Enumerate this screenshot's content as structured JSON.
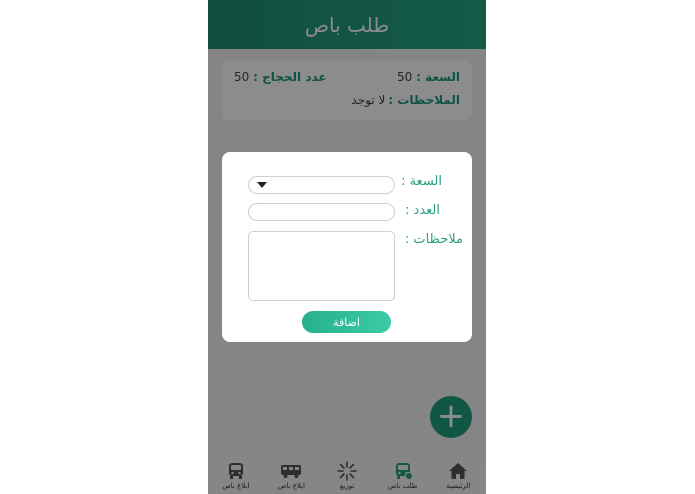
{
  "appbar": {
    "title": "طلب باص"
  },
  "summary_card": {
    "capacity_label": "السعة :",
    "capacity_value": "50",
    "pilgrims_label": "عدد الحجاج :",
    "pilgrims_value": "50",
    "notes_label": "الملاحظات :",
    "notes_value": "لا توجد"
  },
  "bottom_nav": {
    "items": [
      {
        "label": "الرئيسية",
        "icon": "home-icon"
      },
      {
        "label": "طلب باص",
        "icon": "bus-add-icon"
      },
      {
        "label": "توزيع",
        "icon": "distribute-icon"
      },
      {
        "label": "ابلاغ باص",
        "icon": "bus-report-icon"
      },
      {
        "label": "ابلاغ باص",
        "icon": "bus-report-icon"
      }
    ]
  },
  "dialog": {
    "capacity_label": "السعة :",
    "capacity_selected": "",
    "count_label": "العدد :",
    "count_value": "",
    "notes_label": "ملاحظات :",
    "notes_value": "",
    "submit_label": "اضافة"
  },
  "colors": {
    "primary": "#1f9e80",
    "accent_label": "#2a9d82",
    "overlay": "#00000073"
  }
}
